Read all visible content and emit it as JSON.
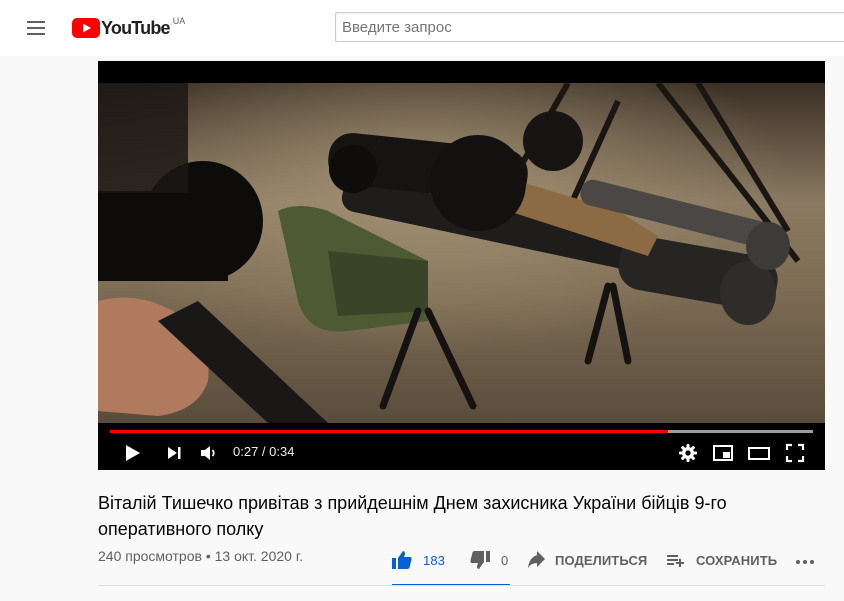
{
  "masthead": {
    "logo_text": "YouTube",
    "country_code": "UA",
    "search_placeholder": "Введите запрос",
    "icons": [
      "menu-icon",
      "youtube-logo-icon"
    ]
  },
  "player": {
    "time_display": "0:27 / 0:34",
    "progress_fraction": 0.7941,
    "accent_color": "#ff0000",
    "controls": [
      "play-icon",
      "next-icon",
      "volume-icon",
      "settings-icon",
      "miniplayer-icon",
      "theater-icon",
      "fullscreen-icon"
    ]
  },
  "video": {
    "title": "Віталій Тишечко привітав з прийдешнім Днем захисника України бійців 9-го оперативного полку",
    "views": "240 просмотров",
    "separator": "•",
    "date": "13 окт. 2020 г."
  },
  "actions": {
    "likes": "183",
    "dislikes": "0",
    "share_label": "ПОДЕЛИТЬСЯ",
    "save_label": "СОХРАНИТЬ",
    "like_ratio": 1.0,
    "like_color": "#065fd4"
  }
}
